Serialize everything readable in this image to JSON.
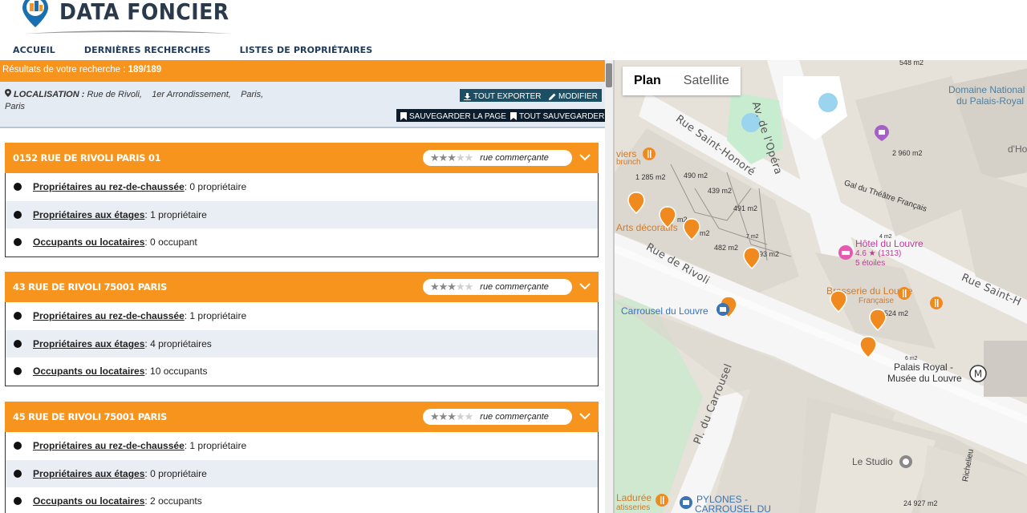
{
  "app": {
    "title": "DATA FONCIER"
  },
  "nav": {
    "home": "ACCUEIL",
    "recent": "DERNIÈRES RECHERCHES",
    "owners": "LISTES DE PROPRIÉTAIRES"
  },
  "results": {
    "label": "Résultats de votre recherche :",
    "count": "189/189"
  },
  "location": {
    "label": "LOCALISATION :",
    "street": "Rue de Rivoli,",
    "district": "1er Arrondissement,",
    "city1": "Paris,",
    "city2": "Paris"
  },
  "toolbar": {
    "export_all": "TOUT EXPORTER",
    "modify": "MODIFIER",
    "save_page": "SAUVEGARDER LA PAGE",
    "save_all": "TOUT SAUVEGARDER"
  },
  "cards": [
    {
      "title": "0152 RUE DE RIVOLI PARIS 01",
      "rating": 3,
      "rating_label": "rue commerçante",
      "rows": [
        {
          "key": "Propriétaires au rez-de-chaussée",
          "value": " : 0 propriétaire"
        },
        {
          "key": "Propriétaires aux étages",
          "value": " : 1 propriétaire"
        },
        {
          "key": "Occupants ou locataires",
          "value": " : 0 occupant"
        }
      ]
    },
    {
      "title": "43 RUE DE RIVOLI 75001 PARIS",
      "rating": 3,
      "rating_label": "rue commerçante",
      "rows": [
        {
          "key": "Propriétaires au rez-de-chaussée",
          "value": " : 1 propriétaire"
        },
        {
          "key": "Propriétaires aux étages",
          "value": " : 4 propriétaires"
        },
        {
          "key": "Occupants ou locataires",
          "value": " : 10 occupants"
        }
      ]
    },
    {
      "title": "45 RUE DE RIVOLI 75001 PARIS",
      "rating": 3,
      "rating_label": "rue commerçante",
      "rows": [
        {
          "key": "Propriétaires au rez-de-chaussée",
          "value": " : 1 propriétaire"
        },
        {
          "key": "Propriétaires aux étages",
          "value": " : 0 propriétaire"
        },
        {
          "key": "Occupants ou locataires",
          "value": " : 2 occupants"
        }
      ]
    }
  ],
  "map": {
    "tabs": {
      "plan": "Plan",
      "satellite": "Satellite"
    },
    "streets": {
      "opera": "Av. de l'Opéra",
      "saint_honore": "Rue Saint-Honoré",
      "saint_honore_right": "Rue Saint-H",
      "rivoli": "Rue de Rivoli",
      "carrousel": "Pl. du Carrousel",
      "gal_theatre": "Gal du Théâtre Français",
      "richelieu": "Richelieu"
    },
    "pois": {
      "domaine": "Domaine National",
      "domaine2": "du Palais-Royal",
      "hotel": "Hôtel du Louvre",
      "hotel_rating": "4.6 ★ (1313)",
      "hotel_stars": "5 étoiles",
      "brasserie": "Brasserie du Louvre",
      "brasserie_sub": "Française",
      "carrousel": "Carrousel du Louvre",
      "palais_royal": "Palais Royal -",
      "musee": "Musée du Louvre",
      "studio": "Le Studio",
      "pylones": "PYLONES -",
      "pylones2": "CARROUSEL DU",
      "laduree": "Ladurée",
      "laduree2": "atisseries",
      "arts": "Arts décoratifs",
      "viers": "viers",
      "brunch": "brunch",
      "ho": "d'Ho"
    },
    "areas": {
      "a1": "548 m2",
      "a2": "2 960 m2",
      "a3": "1 285 m2",
      "a4": "490 m2",
      "a5": "439 m2",
      "a6": "491 m2",
      "a7": "482 m2",
      "a8": "93 m2",
      "a9": "524 m2",
      "a10": "24 927 m2",
      "a11": "6 m2",
      "a12": "4 m2",
      "a13": "7 m2",
      "a14": "m2",
      "a15": "m2"
    },
    "markers_colors": {
      "marker": "#f08a1e",
      "road": "#ffffff",
      "building": "#e3ded6"
    }
  },
  "colors": {
    "accent": "#f7941d",
    "nav": "#1d3a5c",
    "button": "#0e1d2c"
  }
}
